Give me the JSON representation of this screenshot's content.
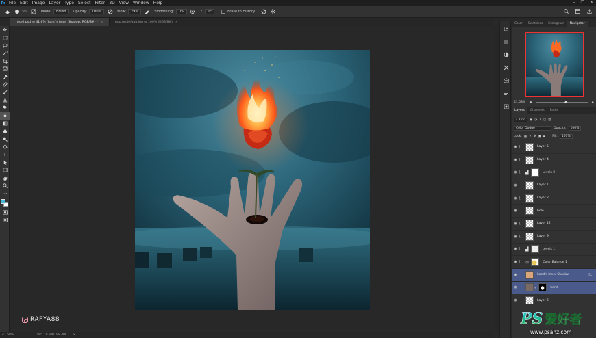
{
  "menu": {
    "app_icon": "Ps",
    "items": [
      "File",
      "Edit",
      "Image",
      "Layer",
      "Type",
      "Select",
      "Filter",
      "3D",
      "View",
      "Window",
      "Help"
    ],
    "window_controls": [
      "–",
      "❐",
      "✕"
    ]
  },
  "options": {
    "mode_label": "Mode:",
    "mode_value": "Brush",
    "opacity_label": "Opacity:",
    "opacity_value": "100%",
    "flow_label": "Flow:",
    "flow_value": "79%",
    "smoothing_label": "Smoothing:",
    "smoothing_value": "0%",
    "angle_value": "0°",
    "erase_history_label": "Erase to History",
    "brush_size": "200"
  },
  "tabs": [
    {
      "label": "rose2.psd @ 41.6% (hand's Inner Shadow, RGB/8#) *",
      "close": "×"
    },
    {
      "label": "maxresdefault.jpg @ 100% (RGB/8#)",
      "close": "×"
    }
  ],
  "status": {
    "zoom": "41.58%",
    "doc": "Doc: 10.3M/198.4M",
    "arrow": ">"
  },
  "watermark": {
    "text": "RAFYA88"
  },
  "navigator": {
    "tabs": [
      "Color",
      "Swatches",
      "Histogram",
      "Navigator"
    ],
    "active": "Navigator",
    "zoom": "41.58%"
  },
  "layers": {
    "tabs": [
      "Layers",
      "Channels",
      "Paths"
    ],
    "kind_label": "Kind",
    "blend_mode": "Color Dodge",
    "opacity_label": "Opacity:",
    "opacity_value": "100%",
    "lock_label": "Lock:",
    "fill_label": "Fill:",
    "fill_value": "100%",
    "items": [
      {
        "name": "Layer 5",
        "clip": true,
        "mask": false
      },
      {
        "name": "Layer 4",
        "clip": true,
        "mask": false
      },
      {
        "name": "Levels 2",
        "clip": true,
        "mask": true,
        "adjust": "levels"
      },
      {
        "name": "Layer 1",
        "clip": false,
        "mask": false
      },
      {
        "name": "Layer 2",
        "clip": true,
        "mask": false
      },
      {
        "name": "hole",
        "clip": false,
        "mask": false
      },
      {
        "name": "Layer 12",
        "clip": true,
        "mask": false
      },
      {
        "name": "Layer 9",
        "clip": true,
        "mask": false
      },
      {
        "name": "Levels 1",
        "clip": true,
        "mask": true,
        "adjust": "levels"
      },
      {
        "name": "Color Balance 1",
        "clip": true,
        "mask": true,
        "adjust": "balance"
      },
      {
        "name": "hand's Inner Shadow",
        "clip": false,
        "mask": false,
        "selected": true,
        "fx": "fx"
      },
      {
        "name": "hand",
        "clip": false,
        "mask": true,
        "selected": true
      },
      {
        "name": "Layer 6",
        "clip": false,
        "mask": false
      }
    ]
  },
  "logo": {
    "brand": "PS",
    "chinese": "爱好者",
    "url": "www.psahz.com"
  },
  "colors": {
    "accent": "#31a8ff",
    "selection": "#4a5a8a",
    "fg_swatch": "#4ab6d6",
    "bg_swatch": "#ffffff",
    "navigator_frame": "#ee3333"
  }
}
